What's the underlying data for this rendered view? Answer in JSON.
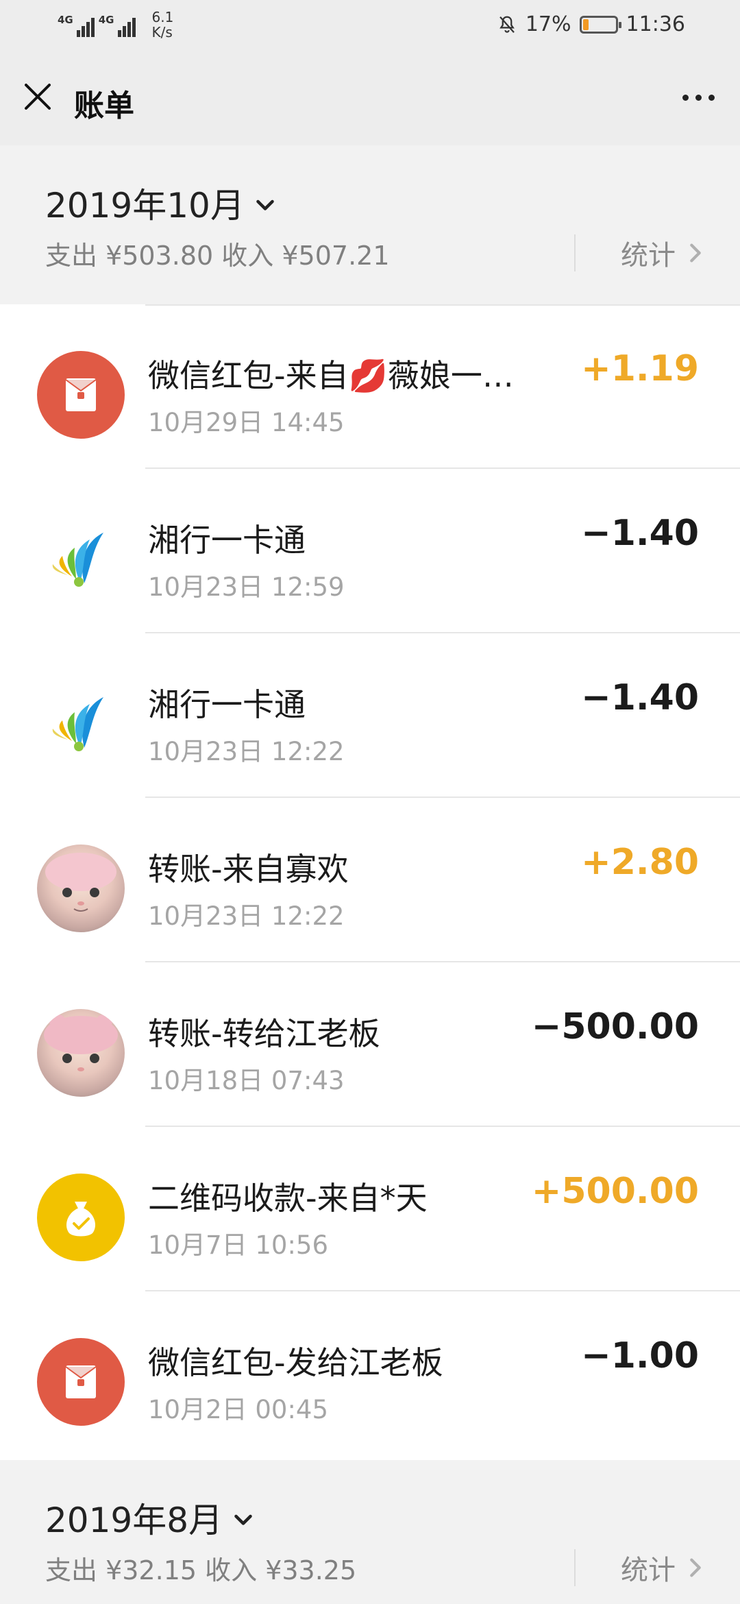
{
  "status_bar": {
    "signal1_label": "4G",
    "signal2_label": "4G",
    "speed_value": "6.1",
    "speed_unit": "K/s",
    "battery_text": "17%",
    "battery_level": 0.17,
    "time": "11:36"
  },
  "appbar": {
    "title": "账单"
  },
  "months": [
    {
      "title": "2019年10月",
      "summary": "支出 ¥503.80 收入 ¥507.21",
      "stats_label": "统计"
    },
    {
      "title": "2019年8月",
      "summary": "支出 ¥32.15 收入 ¥33.25",
      "stats_label": "统计"
    }
  ],
  "transactions": [
    {
      "title": "微信红包-来自💋薇娘一…",
      "date": "10月29日 14:45",
      "amount": "+1.19",
      "icon": "red-packet-icon"
    },
    {
      "title": "湘行一卡通",
      "date": "10月23日 12:59",
      "amount": "−1.40",
      "icon": "transit-card-logo-icon"
    },
    {
      "title": "湘行一卡通",
      "date": "10月23日 12:22",
      "amount": "−1.40",
      "icon": "transit-card-logo-icon"
    },
    {
      "title": "转账-来自寡欢",
      "date": "10月23日 12:22",
      "amount": "+2.80",
      "icon": "cat-avatar"
    },
    {
      "title": "转账-转给江老板",
      "date": "10月18日 07:43",
      "amount": "−500.00",
      "icon": "cat-avatar"
    },
    {
      "title": "二维码收款-来自*天",
      "date": "10月7日 10:56",
      "amount": "+500.00",
      "icon": "money-bag-icon"
    },
    {
      "title": "微信红包-发给江老板",
      "date": "10月2日 00:45",
      "amount": "−1.00",
      "icon": "red-packet-icon"
    }
  ],
  "colors": {
    "income": "#efa928",
    "expense": "#1b1b1b",
    "red_packet": "#e05a45",
    "qr_collect": "#f2c200"
  }
}
